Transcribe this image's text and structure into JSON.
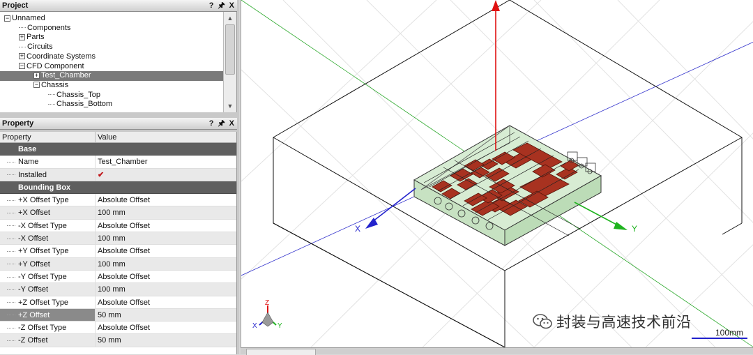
{
  "project_panel": {
    "title": "Project",
    "controls": [
      "?",
      "p",
      "X"
    ],
    "tree": [
      {
        "label": "Unnamed",
        "indent": 0,
        "expander": "−"
      },
      {
        "label": "Components",
        "indent": 1,
        "expander": ""
      },
      {
        "label": "Parts",
        "indent": 1,
        "expander": "+"
      },
      {
        "label": "Circuits",
        "indent": 1,
        "expander": ""
      },
      {
        "label": "Coordinate Systems",
        "indent": 1,
        "expander": "+"
      },
      {
        "label": "CFD Component",
        "indent": 1,
        "expander": "−"
      },
      {
        "label": "Test_Chamber",
        "indent": 2,
        "expander": "+",
        "selected": true
      },
      {
        "label": "Chassis",
        "indent": 2,
        "expander": "−"
      },
      {
        "label": "Chassis_Top",
        "indent": 3,
        "expander": ""
      },
      {
        "label": "Chassis_Bottom",
        "indent": 3,
        "expander": ""
      }
    ]
  },
  "property_panel": {
    "title": "Property",
    "controls": [
      "?",
      "p",
      "X"
    ],
    "col_property": "Property",
    "col_value": "Value",
    "rows": [
      {
        "type": "group",
        "label": "Base"
      },
      {
        "type": "prop",
        "label": "Name",
        "value": "Test_Chamber"
      },
      {
        "type": "check",
        "label": "Installed",
        "value": "✔"
      },
      {
        "type": "group",
        "label": "Bounding Box"
      },
      {
        "type": "prop",
        "label": "+X Offset Type",
        "value": "Absolute Offset"
      },
      {
        "type": "prop",
        "label": "+X Offset",
        "value": "100 mm"
      },
      {
        "type": "prop",
        "label": "-X Offset Type",
        "value": "Absolute Offset"
      },
      {
        "type": "prop",
        "label": "-X Offset",
        "value": "100 mm"
      },
      {
        "type": "prop",
        "label": "+Y Offset Type",
        "value": "Absolute Offset"
      },
      {
        "type": "prop",
        "label": "+Y Offset",
        "value": "100 mm"
      },
      {
        "type": "prop",
        "label": "-Y Offset Type",
        "value": "Absolute Offset"
      },
      {
        "type": "prop",
        "label": "-Y Offset",
        "value": "100 mm"
      },
      {
        "type": "prop",
        "label": "+Z Offset Type",
        "value": "Absolute Offset"
      },
      {
        "type": "prop",
        "label": "+Z Offset",
        "value": "50 mm",
        "selected": true
      },
      {
        "type": "prop",
        "label": "-Z Offset Type",
        "value": "Absolute Offset"
      },
      {
        "type": "prop",
        "label": "-Z Offset",
        "value": "50 mm"
      }
    ]
  },
  "viewport": {
    "axis_x": "X",
    "axis_y": "Y",
    "triad_z": "Z",
    "triad_x": "X",
    "triad_y": "Y",
    "scale_label": "100mm",
    "watermark": "封装与高速技术前沿",
    "colors": {
      "x_axis": "#2222cc",
      "y_axis": "#1fb31f",
      "z_axis": "#e01010",
      "component": "#a83220",
      "chassis": "#cfe7cc"
    }
  }
}
